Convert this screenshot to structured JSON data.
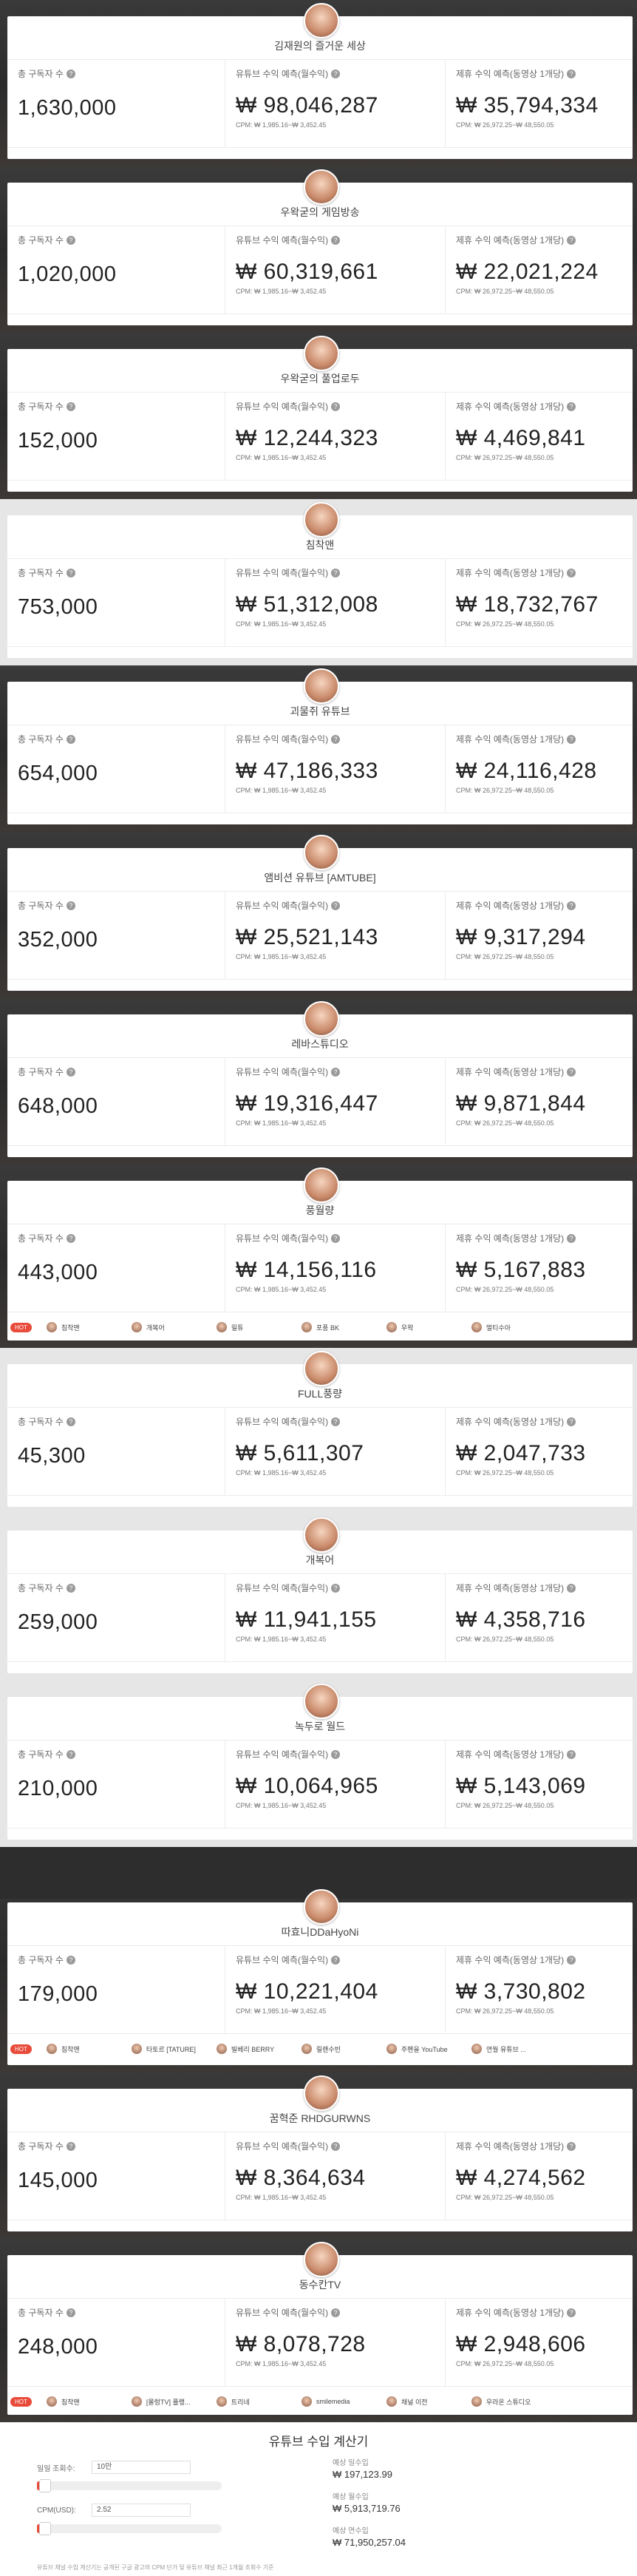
{
  "labels": {
    "subscribers": "총 구독자 수",
    "youtube_revenue": "유튜브 수익 예측(월수익)",
    "sponsor_revenue": "제휴 수익 예측(동영상 1개당)",
    "cpm_youtube": "CPM: ₩ 1,985.16~₩ 3,452.45",
    "cpm_sponsor": "CPM: ₩ 26,972.25~₩ 48,550.05",
    "info_glyph": "?"
  },
  "channels": [
    {
      "name": "김재원의 즐거운 세상",
      "subscribers": "1,630,000",
      "youtube": "₩ 98,046,287",
      "sponsor": "₩ 35,794,334"
    },
    {
      "name": "우왁굳의 게임방송",
      "subscribers": "1,020,000",
      "youtube": "₩ 60,319,661",
      "sponsor": "₩ 22,021,224"
    },
    {
      "name": "우왁굳의 풀업로두",
      "subscribers": "152,000",
      "youtube": "₩ 12,244,323",
      "sponsor": "₩ 4,469,841"
    },
    {
      "name": "침착맨",
      "subscribers": "753,000",
      "youtube": "₩ 51,312,008",
      "sponsor": "₩ 18,732,767"
    },
    {
      "name": "괴물쥐 유튜브",
      "subscribers": "654,000",
      "youtube": "₩ 47,186,333",
      "sponsor": "₩ 24,116,428"
    },
    {
      "name": "앰비션 유튜브 [AMTUBE]",
      "subscribers": "352,000",
      "youtube": "₩ 25,521,143",
      "sponsor": "₩ 9,317,294"
    },
    {
      "name": "레바스튜디오",
      "subscribers": "648,000",
      "youtube": "₩ 19,316,447",
      "sponsor": "₩ 9,871,844"
    },
    {
      "name": "풍월량",
      "subscribers": "443,000",
      "youtube": "₩ 14,156,116",
      "sponsor": "₩ 5,167,883",
      "related_tag": "HOT",
      "related": [
        "침착맨",
        "개복어",
        "릴튜",
        "포풍 BK",
        "우왁",
        "멀티수아"
      ]
    },
    {
      "name": "FULL풍량",
      "subscribers": "45,300",
      "youtube": "₩ 5,611,307",
      "sponsor": "₩ 2,047,733"
    },
    {
      "name": "개복어",
      "subscribers": "259,000",
      "youtube": "₩ 11,941,155",
      "sponsor": "₩ 4,358,716"
    },
    {
      "name": "녹두로 월드",
      "subscribers": "210,000",
      "youtube": "₩ 10,064,965",
      "sponsor": "₩ 5,143,069"
    },
    {
      "name": "따효니DDaHyoNi",
      "subscribers": "179,000",
      "youtube": "₩ 10,221,404",
      "sponsor": "₩ 3,730,802",
      "related_tag": "HOT",
      "related": [
        "침착맨",
        "타토르 [TATURE]",
        "빌베리 BERRY",
        "릴랜수빈",
        "주펜을 YouTube",
        "연월 유튜브 ..."
      ]
    },
    {
      "name": "꿈혁준 RHDGURWNS",
      "subscribers": "145,000",
      "youtube": "₩ 8,364,634",
      "sponsor": "₩ 4,274,562"
    },
    {
      "name": "동수칸TV",
      "subscribers": "248,000",
      "youtube": "₩ 8,078,728",
      "sponsor": "₩ 2,948,606",
      "related_tag": "HOT",
      "related": [
        "침착맨",
        "[몰렁TV] 플랭...",
        "트리네",
        "smilemedia",
        "채널 이전",
        "우라온 스튜디오"
      ]
    }
  ],
  "calculator": {
    "title": "유튜브 수입 계산기",
    "daily_views_label": "일일 조회수:",
    "daily_views_value": "10만",
    "cpm_label": "CPM(USD):",
    "cpm_value": "2.52",
    "daily_views_fill_pct": 2,
    "cpm_fill_pct": 2,
    "daily_income_label": "예상 일수입",
    "daily_income": "₩ 197,123.99",
    "monthly_income_label": "예상 월수입",
    "monthly_income": "₩ 5,913,719.76",
    "yearly_income_label": "예상 연수입",
    "yearly_income": "₩ 71,950,257.04",
    "note": "유튜브 채널 수입 계산기는 공개된 구글 광고의 CPM 단가 및 유튜브 채널 최근 1개월 조회수 기준"
  }
}
